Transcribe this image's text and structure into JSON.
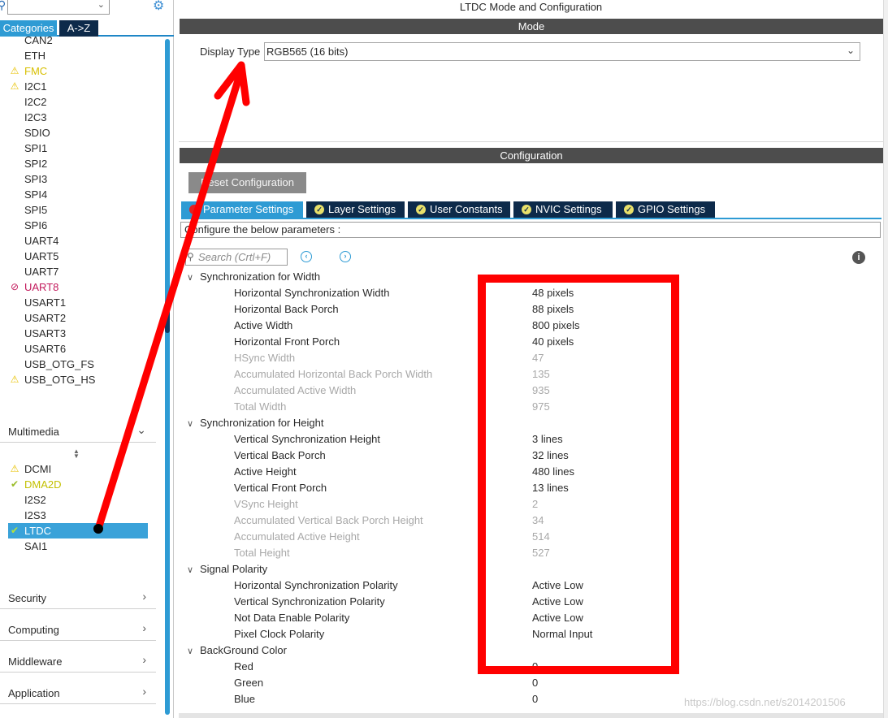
{
  "sidebar": {
    "tabs": {
      "categories": "Categories",
      "atoz": "A->Z"
    },
    "peripherals": [
      {
        "label": "CAN2",
        "state": "none"
      },
      {
        "label": "ETH",
        "state": "none"
      },
      {
        "label": "FMC",
        "state": "warn-yellow"
      },
      {
        "label": "I2C1",
        "state": "warn"
      },
      {
        "label": "I2C2",
        "state": "none"
      },
      {
        "label": "I2C3",
        "state": "none"
      },
      {
        "label": "SDIO",
        "state": "none"
      },
      {
        "label": "SPI1",
        "state": "none"
      },
      {
        "label": "SPI2",
        "state": "none"
      },
      {
        "label": "SPI3",
        "state": "none"
      },
      {
        "label": "SPI4",
        "state": "none"
      },
      {
        "label": "SPI5",
        "state": "none"
      },
      {
        "label": "SPI6",
        "state": "none"
      },
      {
        "label": "UART4",
        "state": "none"
      },
      {
        "label": "UART5",
        "state": "none"
      },
      {
        "label": "UART7",
        "state": "none"
      },
      {
        "label": "UART8",
        "state": "err"
      },
      {
        "label": "USART1",
        "state": "none"
      },
      {
        "label": "USART2",
        "state": "none"
      },
      {
        "label": "USART3",
        "state": "none"
      },
      {
        "label": "USART6",
        "state": "none"
      },
      {
        "label": "USB_OTG_FS",
        "state": "none"
      },
      {
        "label": "USB_OTG_HS",
        "state": "warn"
      }
    ],
    "multimedia": {
      "title": "Multimedia",
      "items": [
        {
          "label": "DCMI",
          "state": "warn"
        },
        {
          "label": "DMA2D",
          "state": "ok-yellow"
        },
        {
          "label": "I2S2",
          "state": "none"
        },
        {
          "label": "I2S3",
          "state": "none"
        },
        {
          "label": "LTDC",
          "state": "selected"
        },
        {
          "label": "SAI1",
          "state": "none"
        }
      ]
    },
    "sections": [
      "Security",
      "Computing",
      "Middleware",
      "Application"
    ]
  },
  "main": {
    "title": "LTDC Mode and Configuration",
    "mode_bar": "Mode",
    "display_type_label": "Display Type",
    "display_type_value": "RGB565 (16 bits)",
    "config_bar": "Configuration",
    "reset_button": "Reset Configuration",
    "tabs": [
      "Parameter Settings",
      "Layer Settings",
      "User Constants",
      "NVIC Settings",
      "GPIO Settings"
    ],
    "caption": "Configure the below parameters :",
    "search_placeholder": "Search (Crtl+F)",
    "groups": [
      {
        "title": "Synchronization for Width",
        "params": [
          {
            "name": "Horizontal Synchronization Width",
            "value": "48 pixels",
            "readonly": false
          },
          {
            "name": "Horizontal Back Porch",
            "value": "88 pixels",
            "readonly": false
          },
          {
            "name": "Active Width",
            "value": "800 pixels",
            "readonly": false
          },
          {
            "name": "Horizontal Front Porch",
            "value": "40 pixels",
            "readonly": false
          },
          {
            "name": "HSync Width",
            "value": "47",
            "readonly": true
          },
          {
            "name": "Accumulated Horizontal Back Porch Width",
            "value": "135",
            "readonly": true
          },
          {
            "name": "Accumulated Active Width",
            "value": "935",
            "readonly": true
          },
          {
            "name": "Total Width",
            "value": "975",
            "readonly": true
          }
        ]
      },
      {
        "title": "Synchronization for Height",
        "params": [
          {
            "name": "Vertical Synchronization Height",
            "value": "3 lines",
            "readonly": false
          },
          {
            "name": "Vertical Back Porch",
            "value": "32 lines",
            "readonly": false
          },
          {
            "name": "Active Height",
            "value": "480 lines",
            "readonly": false
          },
          {
            "name": "Vertical Front Porch",
            "value": "13 lines",
            "readonly": false
          },
          {
            "name": "VSync Height",
            "value": "2",
            "readonly": true
          },
          {
            "name": "Accumulated Vertical Back Porch Height",
            "value": "34",
            "readonly": true
          },
          {
            "name": "Accumulated Active Height",
            "value": "514",
            "readonly": true
          },
          {
            "name": "Total Height",
            "value": "527",
            "readonly": true
          }
        ]
      },
      {
        "title": "Signal Polarity",
        "params": [
          {
            "name": "Horizontal Synchronization Polarity",
            "value": "Active Low",
            "readonly": false
          },
          {
            "name": "Vertical Synchronization Polarity",
            "value": "Active Low",
            "readonly": false
          },
          {
            "name": "Not Data Enable Polarity",
            "value": "Active Low",
            "readonly": false
          },
          {
            "name": "Pixel Clock Polarity",
            "value": "Normal Input",
            "readonly": false
          }
        ]
      },
      {
        "title": "BackGround Color",
        "params": [
          {
            "name": "Red",
            "value": "0",
            "readonly": false
          },
          {
            "name": "Green",
            "value": "0",
            "readonly": false
          },
          {
            "name": "Blue",
            "value": "0",
            "readonly": false
          }
        ]
      }
    ]
  },
  "watermark": "https://blog.csdn.net/s2014201506",
  "colors": {
    "accent": "#2e9bd4",
    "dark_tab": "#0d2a4a",
    "annotation": "#ff0000",
    "bar": "#4d4d4d"
  }
}
